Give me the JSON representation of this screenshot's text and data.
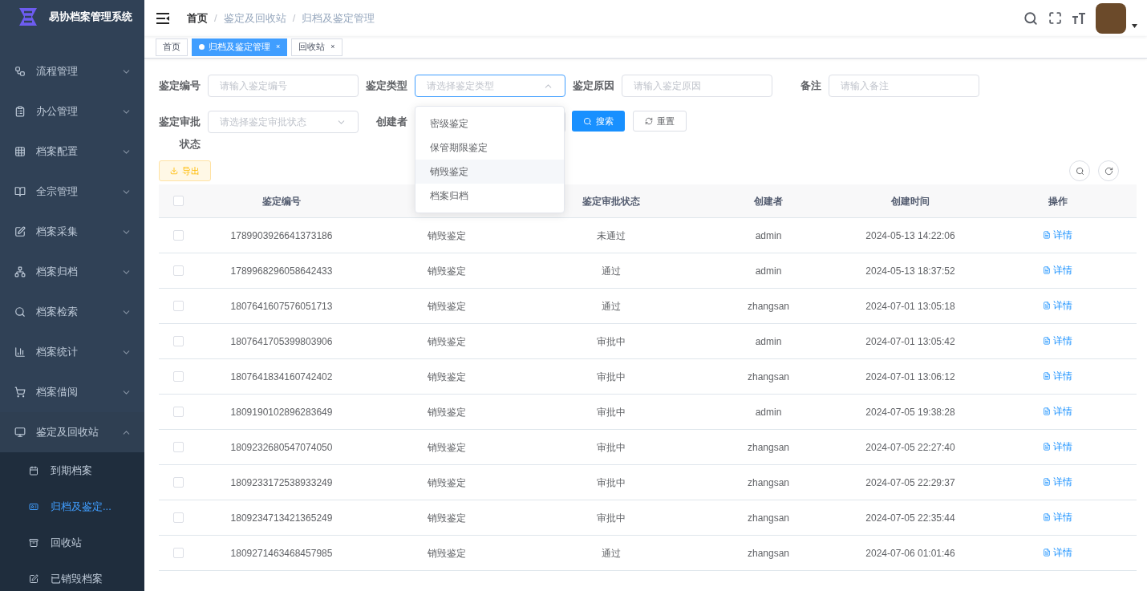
{
  "app": {
    "title": "易协档案管理系统"
  },
  "sidebar": {
    "items": [
      {
        "label": "流程管理",
        "expanded": false
      },
      {
        "label": "办公管理",
        "expanded": false
      },
      {
        "label": "档案配置",
        "expanded": false
      },
      {
        "label": "全宗管理",
        "expanded": false
      },
      {
        "label": "档案采集",
        "expanded": false
      },
      {
        "label": "档案归档",
        "expanded": false
      },
      {
        "label": "档案检索",
        "expanded": false
      },
      {
        "label": "档案统计",
        "expanded": false
      },
      {
        "label": "档案借阅",
        "expanded": false
      },
      {
        "label": "鉴定及回收站",
        "expanded": true,
        "children": [
          {
            "label": "到期档案",
            "selected": false
          },
          {
            "label": "归档及鉴定...",
            "selected": true
          },
          {
            "label": "回收站",
            "selected": false
          },
          {
            "label": "已销毁档案",
            "selected": false
          }
        ]
      }
    ]
  },
  "breadcrumb": [
    "首页",
    "鉴定及回收站",
    "归档及鉴定管理"
  ],
  "breadcrumb_separator": "/",
  "tabs": [
    {
      "label": "首页",
      "selected": false,
      "closable": false
    },
    {
      "label": "归档及鉴定管理",
      "selected": true,
      "closable": true
    },
    {
      "label": "回收站",
      "selected": false,
      "closable": true
    }
  ],
  "tab_close": "×",
  "filters": [
    {
      "label": "鉴定编号",
      "kind": "input",
      "placeholder": "请输入鉴定编号"
    },
    {
      "label": "鉴定类型",
      "kind": "select",
      "placeholder": "请选择鉴定类型",
      "open": true,
      "options": [
        {
          "label": "密级鉴定",
          "hovered": false
        },
        {
          "label": "保管期限鉴定",
          "hovered": false
        },
        {
          "label": "销毁鉴定",
          "hovered": true
        },
        {
          "label": "档案归档",
          "hovered": false
        }
      ]
    },
    {
      "label": "鉴定原因",
      "kind": "input",
      "placeholder": "请输入鉴定原因"
    },
    {
      "label": "备注",
      "kind": "input",
      "placeholder": "请输入备注"
    },
    {
      "label": "鉴定审批状态",
      "kind": "select",
      "placeholder": "请选择鉴定审批状态",
      "open": false
    },
    {
      "label": "创建者",
      "kind": "input"
    }
  ],
  "buttons": {
    "search": "搜索",
    "reset": "重置",
    "export": "导出"
  },
  "table": {
    "header_checked": false,
    "columns": [
      "鉴定编号",
      "",
      "鉴定审批状态",
      "创建者",
      "创建时间",
      "操作"
    ],
    "rows": [
      {
        "checked": false,
        "cells": [
          "1789903926641373186",
          "销毁鉴定",
          "未通过",
          "admin",
          "2024-05-13 14:22:06",
          "详情"
        ]
      },
      {
        "checked": false,
        "cells": [
          "1789968296058642433",
          "销毁鉴定",
          "通过",
          "admin",
          "2024-05-13 18:37:52",
          "详情"
        ]
      },
      {
        "checked": false,
        "cells": [
          "1807641607576051713",
          "销毁鉴定",
          "通过",
          "zhangsan",
          "2024-07-01 13:05:18",
          "详情"
        ]
      },
      {
        "checked": false,
        "cells": [
          "1807641705399803906",
          "销毁鉴定",
          "审批中",
          "admin",
          "2024-07-01 13:05:42",
          "详情"
        ]
      },
      {
        "checked": false,
        "cells": [
          "1807641834160742402",
          "销毁鉴定",
          "审批中",
          "zhangsan",
          "2024-07-01 13:06:12",
          "详情"
        ]
      },
      {
        "checked": false,
        "cells": [
          "1809190102896283649",
          "销毁鉴定",
          "审批中",
          "admin",
          "2024-07-05 19:38:28",
          "详情"
        ]
      },
      {
        "checked": false,
        "cells": [
          "1809232680547074050",
          "销毁鉴定",
          "审批中",
          "zhangsan",
          "2024-07-05 22:27:40",
          "详情"
        ]
      },
      {
        "checked": false,
        "cells": [
          "1809233172538933249",
          "销毁鉴定",
          "审批中",
          "zhangsan",
          "2024-07-05 22:29:37",
          "详情"
        ]
      },
      {
        "checked": false,
        "cells": [
          "1809234713421365249",
          "销毁鉴定",
          "审批中",
          "zhangsan",
          "2024-07-05 22:35:44",
          "详情"
        ]
      },
      {
        "checked": false,
        "cells": [
          "1809271463468457985",
          "销毁鉴定",
          "通过",
          "zhangsan",
          "2024-07-06 01:01:46",
          "详情"
        ]
      }
    ]
  }
}
